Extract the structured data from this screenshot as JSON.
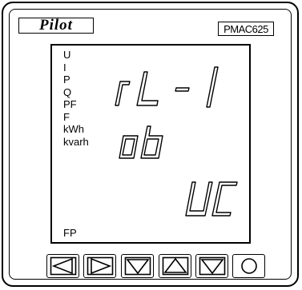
{
  "device": {
    "brand": "Pilot",
    "model": "PMAC625"
  },
  "display": {
    "parameters": [
      "U",
      "I",
      "P",
      "Q",
      "PF",
      "F",
      "kWh",
      "kvarh"
    ],
    "footer_indicator": "FP",
    "line1": "rL - 1",
    "line2": "ob",
    "line3": "UC"
  },
  "buttons": [
    {
      "name": "left-button",
      "icon": "left-arrow-icon"
    },
    {
      "name": "right-button",
      "icon": "right-arrow-icon"
    },
    {
      "name": "down-button",
      "icon": "down-arrow-icon"
    },
    {
      "name": "up-button",
      "icon": "up-arrow-icon"
    },
    {
      "name": "enter-down-button",
      "icon": "down-arrow-icon"
    },
    {
      "name": "circle-button",
      "icon": "circle-icon"
    }
  ]
}
